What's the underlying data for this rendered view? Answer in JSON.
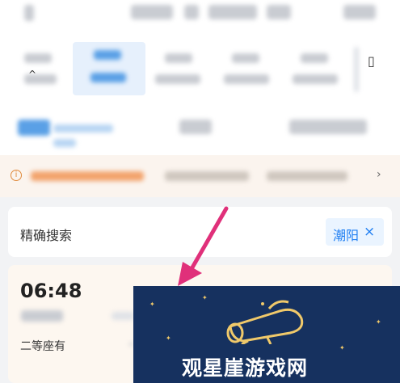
{
  "search": {
    "label": "精确搜索",
    "chip_city": "潮阳",
    "chip_close": "×"
  },
  "train": {
    "depart_time": "06:48",
    "seat_info": "二等座有"
  },
  "banner": {
    "title": "观星崖游戏网"
  },
  "icons": {
    "notice": "info-icon",
    "notice_expand": "chevron-right-icon",
    "pointer": "arrow-pointer-icon",
    "logo": "telescope-logo"
  },
  "colors": {
    "accent": "#1e7ef2",
    "arrow": "#e0307a",
    "notice_bg": "#fbf4ee",
    "card_bg": "#fdf7f0",
    "banner_bg": "#16315f",
    "logo_gold": "#f0c96a"
  }
}
